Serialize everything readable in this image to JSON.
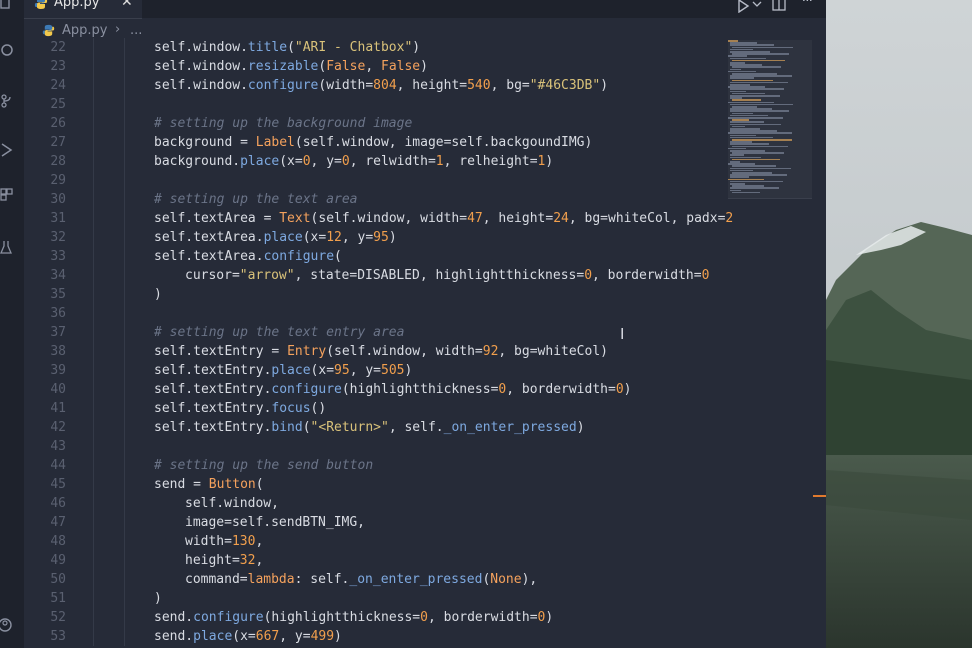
{
  "tab": {
    "label": "App.py",
    "close_icon": "close-icon"
  },
  "breadcrumb": {
    "file": "App.py",
    "separator": "›",
    "more": "..."
  },
  "toolbar": {
    "run_icon": "play-icon",
    "chevron_icon": "chevron-down-icon",
    "split_icon": "split-editor-icon",
    "more_label": "···"
  },
  "colors": {
    "editor_bg": "#262b38",
    "keyword": "#f5a25d",
    "string": "#d9c27a",
    "number": "#f19f4d",
    "function": "#7ea9e0",
    "comment": "#6b7488",
    "scroll_marker": "#e07a2e"
  },
  "code": [
    {
      "n": "22",
      "indent": 1,
      "tokens": [
        [
          "self.window.",
          "p"
        ],
        [
          "title",
          "fn"
        ],
        [
          "(",
          "p"
        ],
        [
          "\"ARI - Chatbox\"",
          "str"
        ],
        [
          ")",
          "p"
        ]
      ]
    },
    {
      "n": "23",
      "indent": 1,
      "tokens": [
        [
          "self.window.",
          "p"
        ],
        [
          "resizable",
          "fn"
        ],
        [
          "(",
          "p"
        ],
        [
          "False",
          "kw"
        ],
        [
          ", ",
          "p"
        ],
        [
          "False",
          "kw"
        ],
        [
          ")",
          "p"
        ]
      ]
    },
    {
      "n": "24",
      "indent": 1,
      "tokens": [
        [
          "self.window.",
          "p"
        ],
        [
          "configure",
          "fn"
        ],
        [
          "(width=",
          "p"
        ],
        [
          "804",
          "num"
        ],
        [
          ", height=",
          "p"
        ],
        [
          "540",
          "num"
        ],
        [
          ", bg=",
          "p"
        ],
        [
          "\"#46C3DB\"",
          "str"
        ],
        [
          ")",
          "p"
        ]
      ]
    },
    {
      "n": "25",
      "indent": 1,
      "tokens": []
    },
    {
      "n": "26",
      "indent": 1,
      "tokens": [
        [
          "# setting up the background image",
          "cm"
        ]
      ]
    },
    {
      "n": "27",
      "indent": 1,
      "tokens": [
        [
          "background = ",
          "p"
        ],
        [
          "Label",
          "cl"
        ],
        [
          "(self.window, image=self.backgoundIMG)",
          "p"
        ]
      ]
    },
    {
      "n": "28",
      "indent": 1,
      "tokens": [
        [
          "background.",
          "p"
        ],
        [
          "place",
          "fn"
        ],
        [
          "(x=",
          "p"
        ],
        [
          "0",
          "num"
        ],
        [
          ", y=",
          "p"
        ],
        [
          "0",
          "num"
        ],
        [
          ", relwidth=",
          "p"
        ],
        [
          "1",
          "num"
        ],
        [
          ", relheight=",
          "p"
        ],
        [
          "1",
          "num"
        ],
        [
          ")",
          "p"
        ]
      ]
    },
    {
      "n": "29",
      "indent": 1,
      "tokens": []
    },
    {
      "n": "30",
      "indent": 1,
      "tokens": [
        [
          "# setting up the text area",
          "cm"
        ]
      ]
    },
    {
      "n": "31",
      "indent": 1,
      "tokens": [
        [
          "self.textArea = ",
          "p"
        ],
        [
          "Text",
          "cl"
        ],
        [
          "(self.window, width=",
          "p"
        ],
        [
          "47",
          "num"
        ],
        [
          ", height=",
          "p"
        ],
        [
          "24",
          "num"
        ],
        [
          ", bg=whiteCol, padx=",
          "p"
        ],
        [
          "2",
          "num"
        ]
      ]
    },
    {
      "n": "32",
      "indent": 1,
      "tokens": [
        [
          "self.textArea.",
          "p"
        ],
        [
          "place",
          "fn"
        ],
        [
          "(x=",
          "p"
        ],
        [
          "12",
          "num"
        ],
        [
          ", y=",
          "p"
        ],
        [
          "95",
          "num"
        ],
        [
          ")",
          "p"
        ]
      ]
    },
    {
      "n": "33",
      "indent": 1,
      "tokens": [
        [
          "self.textArea.",
          "p"
        ],
        [
          "configure",
          "fn"
        ],
        [
          "(",
          "p"
        ]
      ]
    },
    {
      "n": "34",
      "indent": 2,
      "tokens": [
        [
          "cursor=",
          "p"
        ],
        [
          "\"arrow\"",
          "str"
        ],
        [
          ", state=DISABLED, highlightthickness=",
          "p"
        ],
        [
          "0",
          "num"
        ],
        [
          ", borderwidth=",
          "p"
        ],
        [
          "0",
          "num"
        ]
      ]
    },
    {
      "n": "35",
      "indent": 1,
      "tokens": [
        [
          ")",
          "p"
        ]
      ]
    },
    {
      "n": "36",
      "indent": 1,
      "tokens": []
    },
    {
      "n": "37",
      "indent": 1,
      "tokens": [
        [
          "# setting up the text entry area",
          "cm"
        ]
      ]
    },
    {
      "n": "38",
      "indent": 1,
      "tokens": [
        [
          "self.textEntry = ",
          "p"
        ],
        [
          "Entry",
          "cl"
        ],
        [
          "(self.window, width=",
          "p"
        ],
        [
          "92",
          "num"
        ],
        [
          ", bg=whiteCol)",
          "p"
        ]
      ]
    },
    {
      "n": "39",
      "indent": 1,
      "tokens": [
        [
          "self.textEntry.",
          "p"
        ],
        [
          "place",
          "fn"
        ],
        [
          "(x=",
          "p"
        ],
        [
          "95",
          "num"
        ],
        [
          ", y=",
          "p"
        ],
        [
          "505",
          "num"
        ],
        [
          ")",
          "p"
        ]
      ]
    },
    {
      "n": "40",
      "indent": 1,
      "tokens": [
        [
          "self.textEntry.",
          "p"
        ],
        [
          "configure",
          "fn"
        ],
        [
          "(highlightthickness=",
          "p"
        ],
        [
          "0",
          "num"
        ],
        [
          ", borderwidth=",
          "p"
        ],
        [
          "0",
          "num"
        ],
        [
          ")",
          "p"
        ]
      ]
    },
    {
      "n": "41",
      "indent": 1,
      "tokens": [
        [
          "self.textEntry.",
          "p"
        ],
        [
          "focus",
          "fn"
        ],
        [
          "()",
          "p"
        ]
      ]
    },
    {
      "n": "42",
      "indent": 1,
      "tokens": [
        [
          "self.textEntry.",
          "p"
        ],
        [
          "bind",
          "fn"
        ],
        [
          "(",
          "p"
        ],
        [
          "\"<Return>\"",
          "str"
        ],
        [
          ", self.",
          "p"
        ],
        [
          "_on_enter_pressed",
          "fn"
        ],
        [
          ")",
          "p"
        ]
      ]
    },
    {
      "n": "43",
      "indent": 1,
      "tokens": []
    },
    {
      "n": "44",
      "indent": 1,
      "tokens": [
        [
          "# setting up the send button",
          "cm"
        ]
      ]
    },
    {
      "n": "45",
      "indent": 1,
      "tokens": [
        [
          "send = ",
          "p"
        ],
        [
          "Button",
          "cl"
        ],
        [
          "(",
          "p"
        ]
      ]
    },
    {
      "n": "46",
      "indent": 2,
      "tokens": [
        [
          "self.window,",
          "p"
        ]
      ]
    },
    {
      "n": "47",
      "indent": 2,
      "tokens": [
        [
          "image=self.sendBTN_IMG,",
          "p"
        ]
      ]
    },
    {
      "n": "48",
      "indent": 2,
      "tokens": [
        [
          "width=",
          "p"
        ],
        [
          "130",
          "num"
        ],
        [
          ",",
          "p"
        ]
      ]
    },
    {
      "n": "49",
      "indent": 2,
      "tokens": [
        [
          "height=",
          "p"
        ],
        [
          "32",
          "num"
        ],
        [
          ",",
          "p"
        ]
      ]
    },
    {
      "n": "50",
      "indent": 2,
      "tokens": [
        [
          "command=",
          "p"
        ],
        [
          "lambda",
          "kw"
        ],
        [
          ": self.",
          "p"
        ],
        [
          "_on_enter_pressed",
          "fn"
        ],
        [
          "(",
          "p"
        ],
        [
          "None",
          "kw"
        ],
        [
          "),",
          "p"
        ]
      ]
    },
    {
      "n": "51",
      "indent": 1,
      "tokens": [
        [
          ")",
          "p"
        ]
      ]
    },
    {
      "n": "52",
      "indent": 1,
      "tokens": [
        [
          "send.",
          "p"
        ],
        [
          "configure",
          "fn"
        ],
        [
          "(highlightthickness=",
          "p"
        ],
        [
          "0",
          "num"
        ],
        [
          ", borderwidth=",
          "p"
        ],
        [
          "0",
          "num"
        ],
        [
          ")",
          "p"
        ]
      ]
    },
    {
      "n": "53",
      "indent": 1,
      "tokens": [
        [
          "send.",
          "p"
        ],
        [
          "place",
          "fn"
        ],
        [
          "(x=",
          "p"
        ],
        [
          "667",
          "num"
        ],
        [
          ", y=",
          "p"
        ],
        [
          "499",
          "num"
        ],
        [
          ")",
          "p"
        ]
      ]
    }
  ]
}
